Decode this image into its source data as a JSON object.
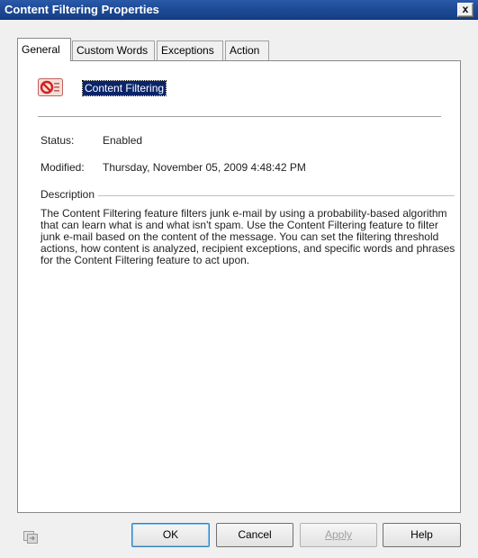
{
  "window": {
    "title": "Content Filtering Properties",
    "close_glyph": "x"
  },
  "tabs": [
    {
      "label": "General",
      "active": true
    },
    {
      "label": "Custom Words",
      "active": false
    },
    {
      "label": "Exceptions",
      "active": false
    },
    {
      "label": "Action",
      "active": false
    }
  ],
  "general": {
    "feature_name": "Content Filtering",
    "icon": "content-filter-no-entry-icon",
    "status_label": "Status:",
    "status_value": "Enabled",
    "modified_label": "Modified:",
    "modified_value": "Thursday, November 05, 2009 4:48:42 PM",
    "description_label": "Description",
    "description_text": "The Content Filtering feature filters junk e-mail by using a probability-based algorithm that can learn what is and what isn't spam. Use the Content Filtering feature to filter junk e-mail based on the content of the message. You can set the filtering threshold actions, how content is analyzed, recipient exceptions, and specific words and phrases for the Content Filtering feature to act upon."
  },
  "buttons": {
    "ok": "OK",
    "cancel": "Cancel",
    "apply": "Apply",
    "help": "Help"
  },
  "colors": {
    "titlebar": "#1d4a96",
    "selection": "#0a246a",
    "icon_red": "#d42020"
  }
}
